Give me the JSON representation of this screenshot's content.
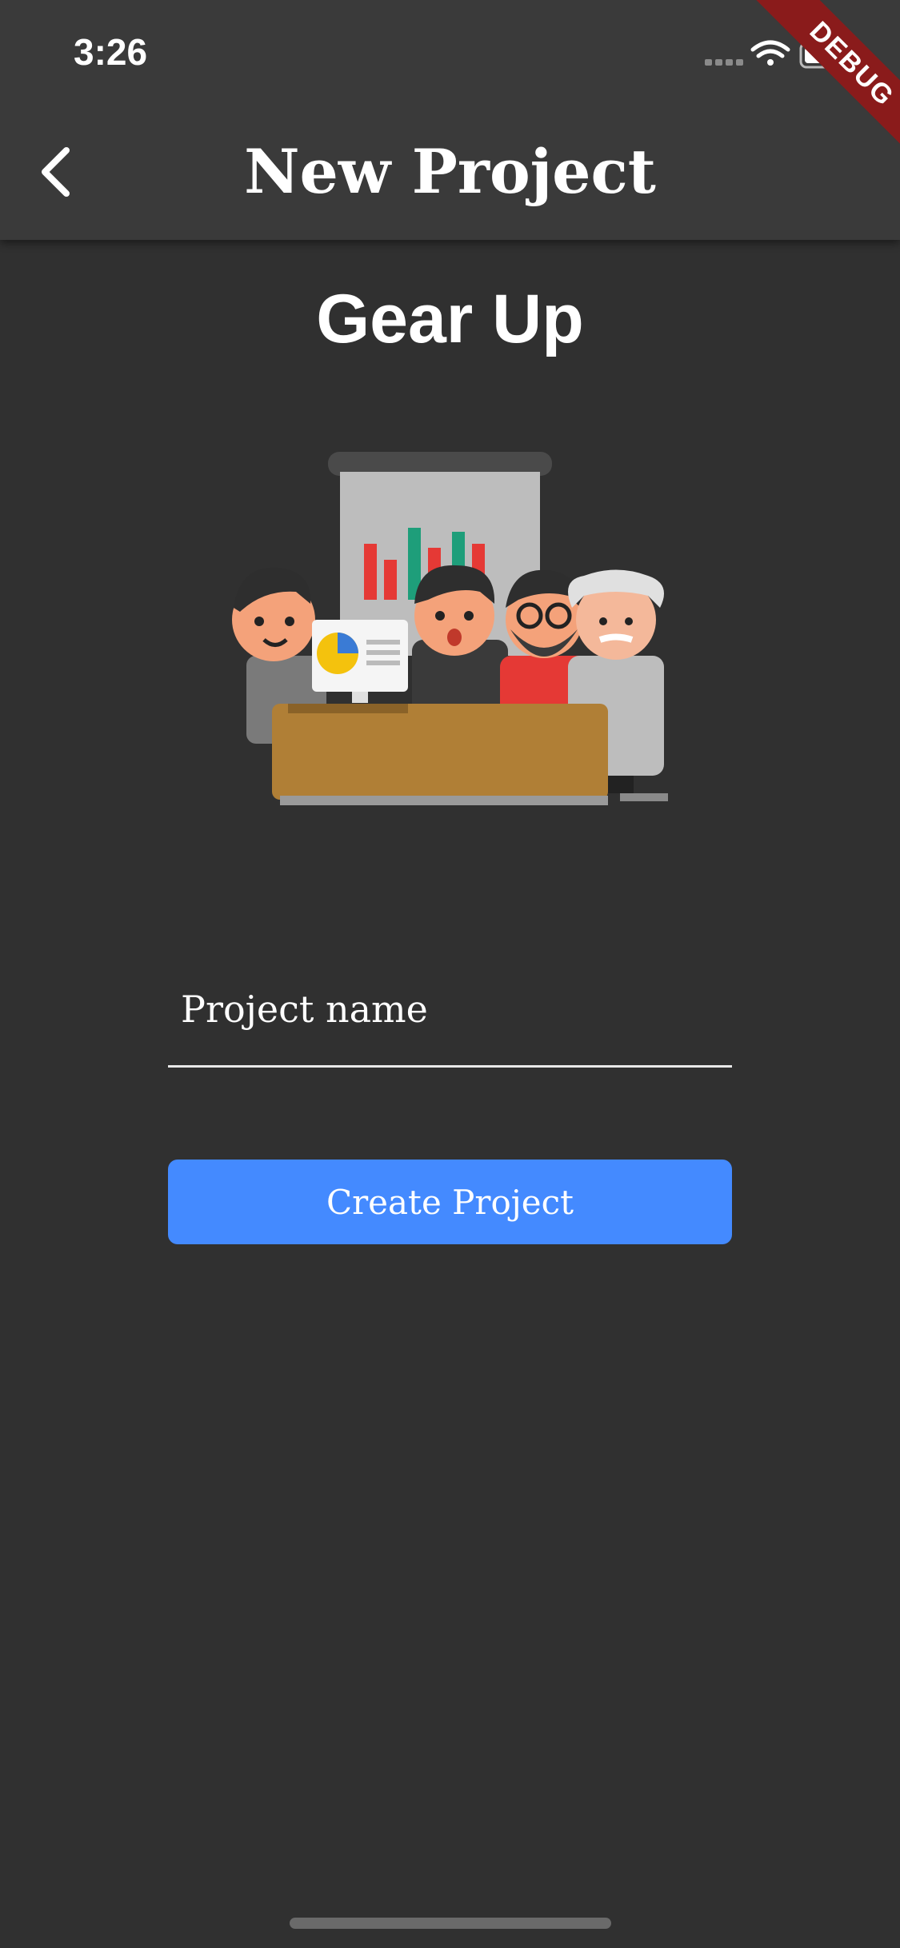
{
  "status_bar": {
    "time": "3:26"
  },
  "debug_banner": {
    "label": "DEBUG"
  },
  "app_bar": {
    "title": "New Project",
    "back_icon": "chevron-left-icon"
  },
  "main": {
    "heading": "Gear Up",
    "illustration": "team-meeting-illustration",
    "project_name_field": {
      "label": "Project name",
      "value": ""
    },
    "create_button": {
      "label": "Create Project"
    }
  },
  "colors": {
    "background": "#303030",
    "app_bar": "#3a3a3a",
    "button": "#448aff",
    "debug_banner": "#8a1b1b"
  }
}
